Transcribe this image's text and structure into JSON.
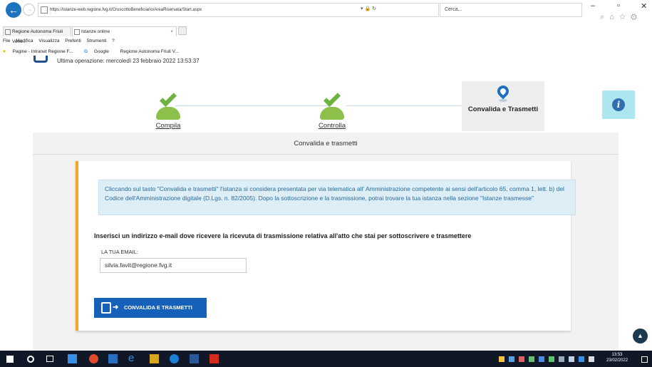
{
  "browser": {
    "url": "https://istanze-web.regione.fvg.it/CruscottoBeneficiario/AreaRiservata/Start.aspx",
    "search_placeholder": "Cerca...",
    "tabs": [
      {
        "label": "Regione Autonoma Friuli Vene..."
      },
      {
        "label": "Istanze online"
      }
    ],
    "menu": [
      "File",
      "Modifica",
      "Visualizza",
      "Preferiti",
      "Strumenti",
      "?"
    ],
    "favorites": [
      "Pagine - Intranet Regione F...",
      "Google",
      "Regione Autonoma Friuli V..."
    ]
  },
  "page": {
    "last_operation": "Ultima operazione: mercoledì 23 febbraio 2022 13:53:37",
    "steps": [
      {
        "label": "Compila",
        "state": "done"
      },
      {
        "label": "Controlla",
        "state": "done"
      },
      {
        "label": "Convalida e Trasmetti",
        "state": "current"
      }
    ],
    "info_icon": "info-icon",
    "panel_title": "Convalida e trasmetti",
    "notice": "Cliccando sul tasto \"Convalida e trasmetti\" l'istanza si considera presentata per via telematica all' Amministrazione competente ai sensi dell'articolo 65, comma 1, lett. b) del Codice dell'Amministrazione digitale (D.Lgs. n. 82/2005). Dopo la sottoscrizione e la trasmissione, potrai trovare la tua istanza nella sezione \"Istanze trasmesse\"",
    "email_question": "Inserisci un indirizzo e-mail dove ricevere la ricevuta di trasmissione relativa all'atto che stai per sottoscrivere e trasmettere",
    "email_label": "LA TUA EMAIL:",
    "email_value": "silvia.favit@regione.fvg.it",
    "submit_label": "CONVALIDA E TRASMETTI"
  },
  "taskbar": {
    "time": "13:53",
    "date": "23/02/2022"
  },
  "colors": {
    "accent_blue": "#1560b8",
    "step_green": "#8cc04a",
    "card_border": "#f5a623",
    "notice_bg": "#ddeef7",
    "taskbar_bg": "#101828"
  }
}
